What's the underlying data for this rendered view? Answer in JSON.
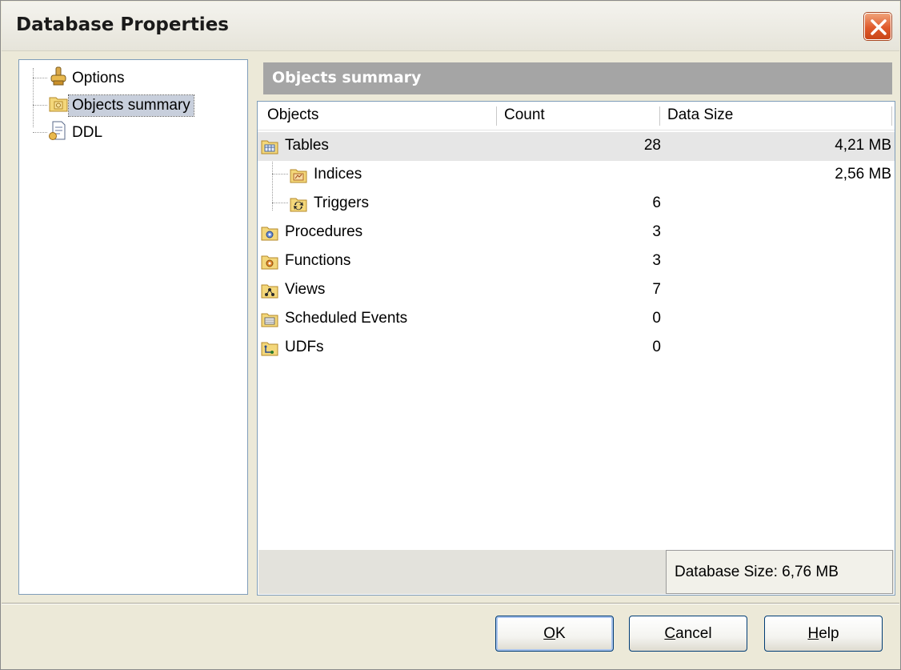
{
  "window": {
    "title": "Database Properties"
  },
  "tree": {
    "items": [
      {
        "label": "Options",
        "icon": "options-icon",
        "selected": false
      },
      {
        "label": "Objects summary",
        "icon": "objects-summary-icon",
        "selected": true
      },
      {
        "label": "DDL",
        "icon": "ddl-icon",
        "selected": false
      }
    ]
  },
  "panel": {
    "header": "Objects summary"
  },
  "table": {
    "columns": [
      "Objects",
      "Count",
      "Data Size"
    ],
    "rows": [
      {
        "name": "Tables",
        "count": "28",
        "size": "4,21 MB",
        "icon": "tables-icon",
        "child": false
      },
      {
        "name": "Indices",
        "count": "",
        "size": "2,56 MB",
        "icon": "indices-icon",
        "child": true
      },
      {
        "name": "Triggers",
        "count": "6",
        "size": "",
        "icon": "triggers-icon",
        "child": true
      },
      {
        "name": "Procedures",
        "count": "3",
        "size": "",
        "icon": "procedures-icon",
        "child": false
      },
      {
        "name": "Functions",
        "count": "3",
        "size": "",
        "icon": "functions-icon",
        "child": false
      },
      {
        "name": "Views",
        "count": "7",
        "size": "",
        "icon": "views-icon",
        "child": false
      },
      {
        "name": "Scheduled Events",
        "count": "0",
        "size": "",
        "icon": "scheduled-events-icon",
        "child": false
      },
      {
        "name": "UDFs",
        "count": "0",
        "size": "",
        "icon": "udfs-icon",
        "child": false
      }
    ],
    "footer": "Database Size: 6,76 MB"
  },
  "buttons": {
    "ok": {
      "mnemonic": "O",
      "rest": "K"
    },
    "cancel": {
      "mnemonic": "C",
      "rest": "ancel"
    },
    "help": {
      "mnemonic": "H",
      "rest": "elp"
    }
  },
  "colors": {
    "dialog_bg": "#ece9d8",
    "header_band": "#a5a5a5",
    "highlight_row": "#e6e6e6",
    "folder_yellow": "#f3d77a",
    "close_red": "#e0592b"
  }
}
